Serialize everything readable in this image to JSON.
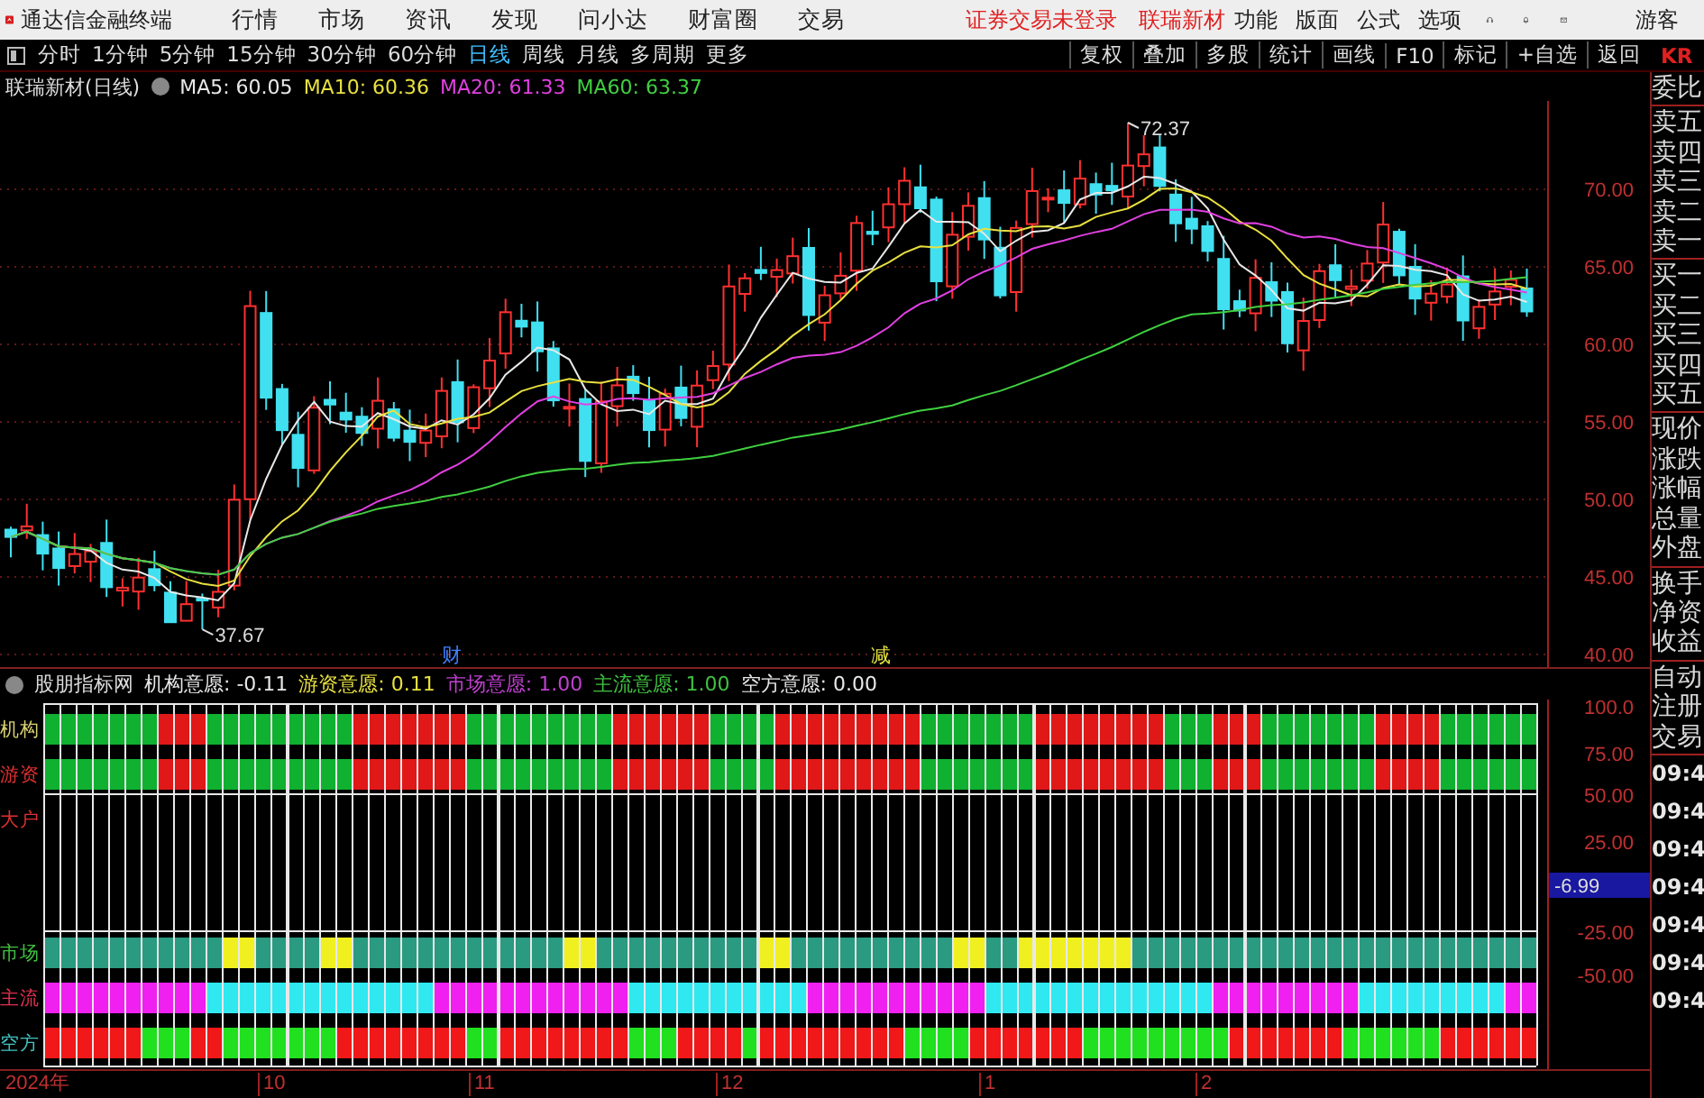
{
  "app_bar": {
    "app_title": "通达信金融终端",
    "menu": [
      "行情",
      "市场",
      "资讯",
      "发现",
      "问小达",
      "财富圈",
      "交易"
    ],
    "notice": "证券交易未登录",
    "stock_link": "联瑞新材",
    "right_menu": [
      "功能",
      "版面",
      "公式",
      "选项"
    ],
    "user": "游客"
  },
  "period_tabs": [
    {
      "label": "分时",
      "selected": false
    },
    {
      "label": "1分钟",
      "selected": false
    },
    {
      "label": "5分钟",
      "selected": false
    },
    {
      "label": "15分钟",
      "selected": false
    },
    {
      "label": "30分钟",
      "selected": false
    },
    {
      "label": "60分钟",
      "selected": false
    },
    {
      "label": "日线",
      "selected": true
    },
    {
      "label": "周线",
      "selected": false
    },
    {
      "label": "月线",
      "selected": false
    },
    {
      "label": "多周期",
      "selected": false
    },
    {
      "label": "更多",
      "selected": false
    }
  ],
  "tool_buttons": [
    "复权",
    "叠加",
    "多股",
    "统计",
    "画线",
    "F10",
    "标记",
    "+自选",
    "返回"
  ],
  "corner_badge": "KR",
  "main_chart": {
    "title": "联瑞新材(日线)",
    "ma": [
      {
        "label": "MA5: 60.05",
        "color": "#e8e8e8"
      },
      {
        "label": "MA10: 60.36",
        "color": "#e8e040"
      },
      {
        "label": "MA20: 61.33",
        "color": "#e040e0"
      },
      {
        "label": "MA60: 63.37",
        "color": "#40d040"
      }
    ],
    "yticks": [
      "70.00",
      "65.00",
      "60.00",
      "55.00",
      "50.00",
      "45.00",
      "40.00"
    ],
    "high_label": "72.37",
    "low_label": "37.67",
    "markers": [
      {
        "text": "财",
        "color": "#4080ff"
      },
      {
        "text": "减",
        "color": "#e0e040"
      }
    ]
  },
  "quote_panel": {
    "groups": [
      [
        "委比"
      ],
      [
        "卖五",
        "卖四",
        "卖三",
        "卖二",
        "卖一"
      ],
      [
        "买一",
        "买二",
        "买三",
        "买四",
        "买五"
      ],
      [
        "现价",
        "涨跌",
        "涨幅",
        "总量",
        "外盘"
      ],
      [
        "换手",
        "净资",
        "收益"
      ],
      [
        "自动",
        "注册",
        "交易"
      ]
    ],
    "times": [
      "09:4",
      "09:4",
      "09:4",
      "09:4",
      "09:4",
      "09:4",
      "09:4"
    ]
  },
  "indicator": {
    "title": "股朋指标网",
    "values": [
      {
        "label": "机构意愿: -0.11",
        "color": "#e8e8e8"
      },
      {
        "label": "游资意愿: 0.11",
        "color": "#e8e040"
      },
      {
        "label": "市场意愿: 1.00",
        "color": "#c040d0"
      },
      {
        "label": "主流意愿: 1.00",
        "color": "#40c040"
      },
      {
        "label": "空方意愿: 0.00",
        "color": "#e8e8e8"
      }
    ],
    "rows": [
      {
        "label": "机构",
        "color": "#d8d070"
      },
      {
        "label": "游资",
        "color": "#e03030"
      },
      {
        "label": "大户",
        "color": "#e03030"
      },
      {
        "label": "市场",
        "color": "#40c040"
      },
      {
        "label": "主流",
        "color": "#e03050"
      },
      {
        "label": "空方",
        "color": "#40c0c0"
      }
    ],
    "yticks": [
      "100.0",
      "75.00",
      "50.00",
      "25.00",
      "-25.00",
      "-50.00"
    ],
    "cursor_value": "-6.99"
  },
  "date_axis": [
    "2024年",
    "10",
    "11",
    "12",
    "1",
    "2"
  ]
}
